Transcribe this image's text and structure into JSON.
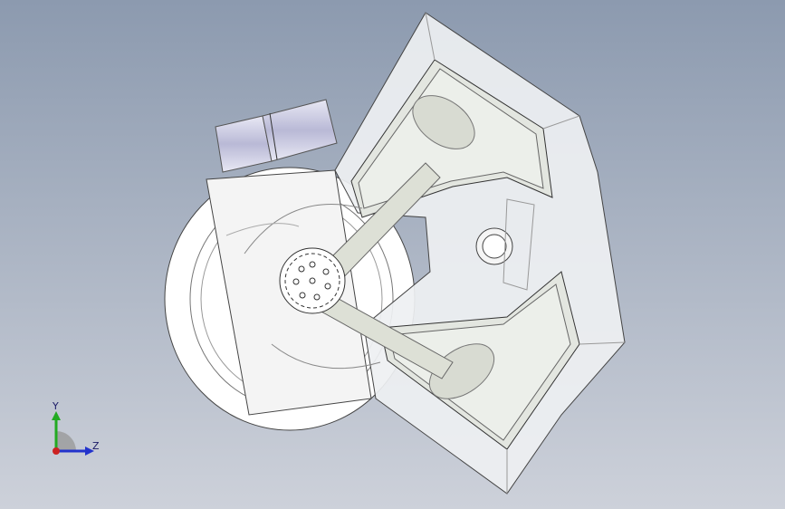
{
  "viewport": {
    "background_top": "#8d9ab0",
    "background_bottom": "#c9ced8",
    "model": {
      "description_icon": "engine-assembly-model"
    }
  },
  "triad": {
    "y_label": "Y",
    "z_label": "Z",
    "colors": {
      "y": "#22aa22",
      "z": "#2233cc",
      "x": "#cc2222"
    }
  }
}
